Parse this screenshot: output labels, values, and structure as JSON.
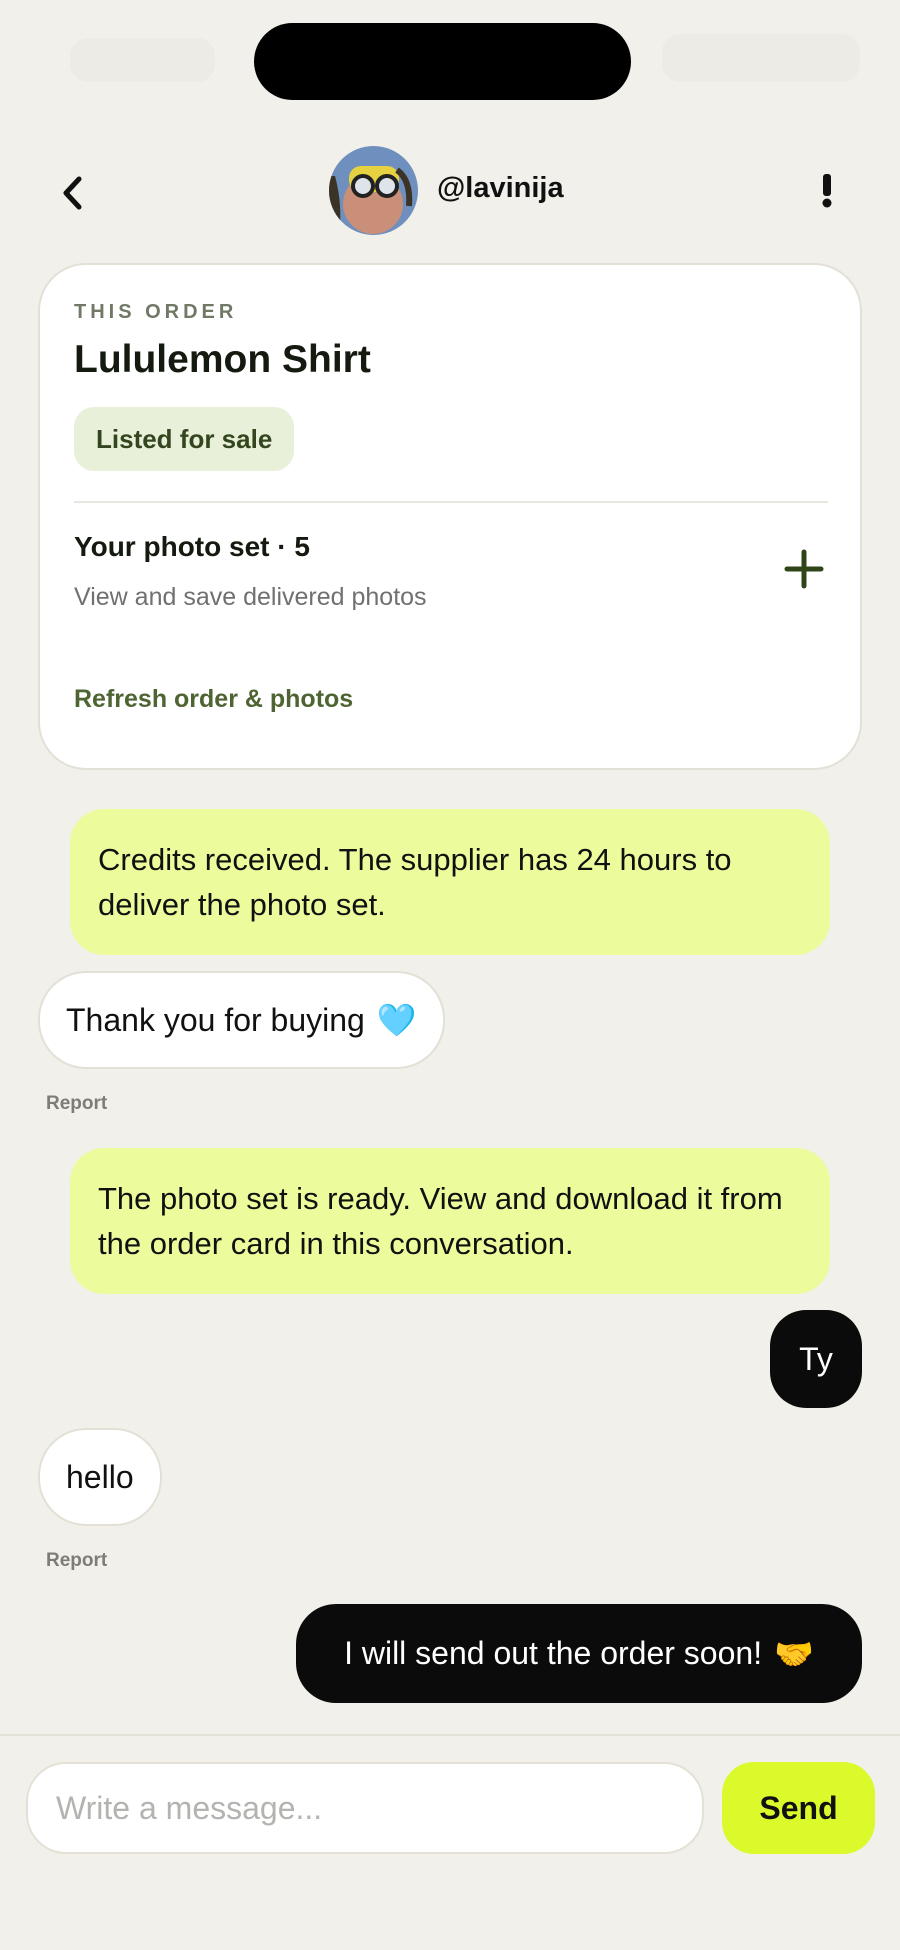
{
  "header": {
    "username": "@lavinija",
    "back_icon": "chevron-left-icon",
    "more_icon": "exclamation-icon"
  },
  "order": {
    "eyebrow": "THIS ORDER",
    "title": "Lululemon Shirt",
    "status": "Listed for sale",
    "photoset_title": "Your photo set · 5",
    "photoset_subtitle": "View and save delivered photos",
    "refresh_label": "Refresh order & photos"
  },
  "messages": {
    "system_1": "Credits received. The supplier has 24 hours to deliver the photo set.",
    "incoming_1": "Thank you for buying",
    "incoming_1_emoji": "🩵",
    "report_1": "Report",
    "system_2": "The photo set is ready. View and download it from the order card in this conversation.",
    "outgoing_1": "Ty",
    "incoming_2": "hello",
    "report_2": "Report",
    "outgoing_2": "I will send out the order soon!",
    "outgoing_2_emoji": "🤝"
  },
  "composer": {
    "placeholder": "Write a message...",
    "value": "",
    "send_label": "Send"
  },
  "colors": {
    "background": "#f1f0ea",
    "system_bubble": "#ecfb9c",
    "send_button": "#dcfa2b",
    "status_pill": "#e9f0da",
    "accent_green": "#4f6433"
  }
}
